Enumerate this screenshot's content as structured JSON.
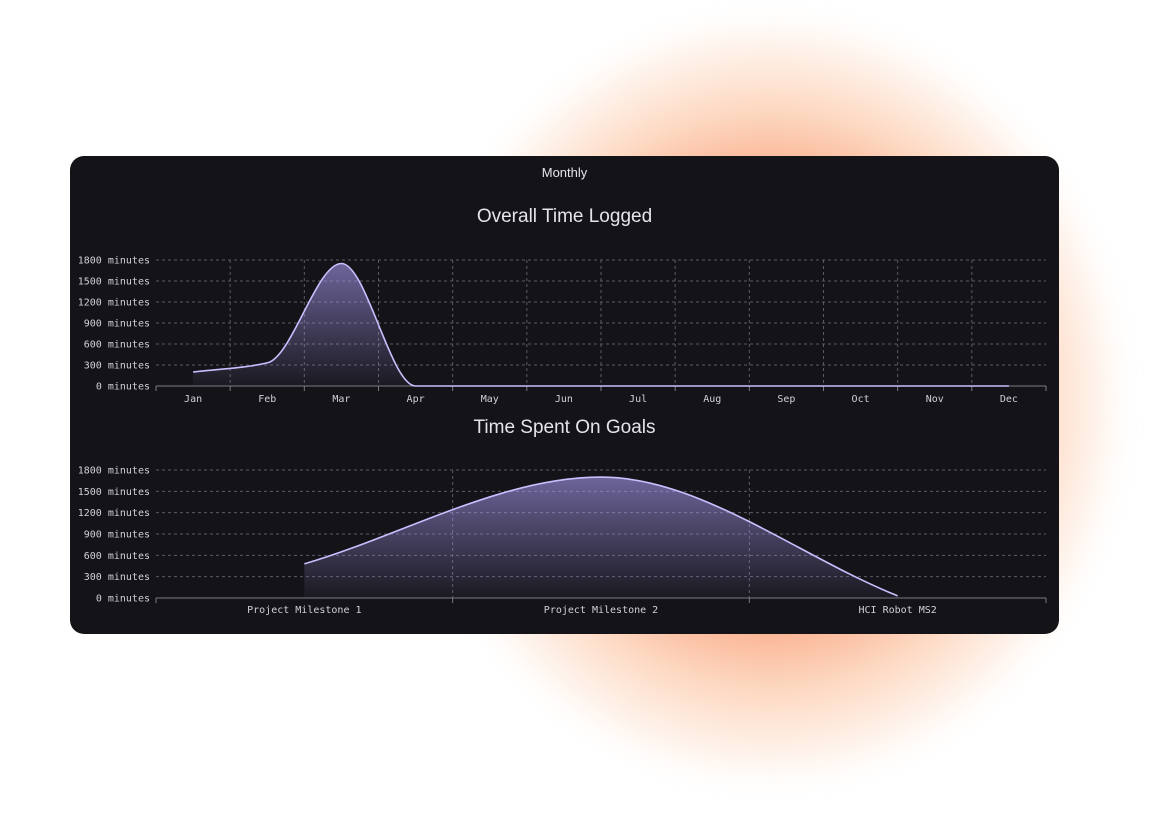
{
  "tab_title": "Monthly",
  "colors": {
    "line": "#c9bfff",
    "area_top": "#a99af0",
    "background": "#141418",
    "glow": "#f67d55"
  },
  "chart_data": [
    {
      "type": "area",
      "title": "Overall Time Logged",
      "categories": [
        "Jan",
        "Feb",
        "Mar",
        "Apr",
        "May",
        "Jun",
        "Jul",
        "Aug",
        "Sep",
        "Oct",
        "Nov",
        "Dec"
      ],
      "values": [
        200,
        330,
        1750,
        0,
        0,
        0,
        0,
        0,
        0,
        0,
        0,
        0
      ],
      "yticks": [
        0,
        300,
        600,
        900,
        1200,
        1500,
        1800
      ],
      "ytick_labels": [
        "0 minutes",
        "300 minutes",
        "600 minutes",
        "900 minutes",
        "1200 minutes",
        "1500 minutes",
        "1800 minutes"
      ],
      "ylim": [
        0,
        1800
      ],
      "grid": true
    },
    {
      "type": "area",
      "title": "Time Spent On Goals",
      "categories": [
        "Project Milestone 1",
        "Project Milestone 2",
        "HCI Robot MS2"
      ],
      "values": [
        480,
        1700,
        30
      ],
      "yticks": [
        0,
        300,
        600,
        900,
        1200,
        1500,
        1800
      ],
      "ytick_labels": [
        "0 minutes",
        "300 minutes",
        "600 minutes",
        "900 minutes",
        "1200 minutes",
        "1500 minutes",
        "1800 minutes"
      ],
      "ylim": [
        0,
        1800
      ],
      "grid": true
    }
  ]
}
